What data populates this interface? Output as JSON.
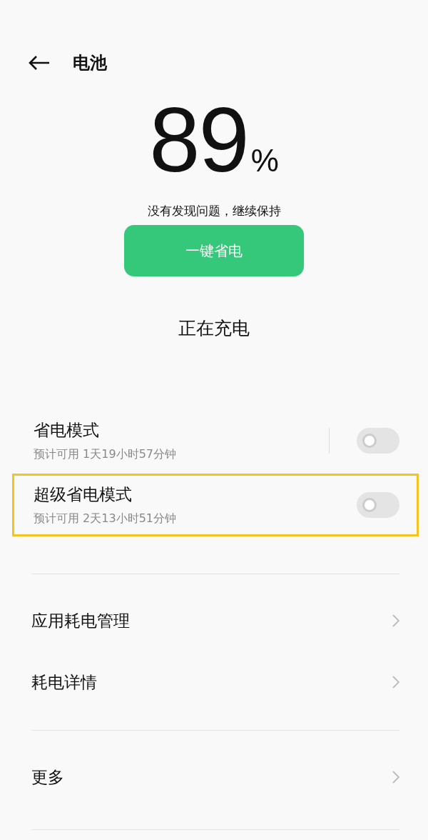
{
  "header": {
    "title": "电池"
  },
  "battery": {
    "value": "89",
    "unit": "%",
    "status": "没有发现问题，继续保持",
    "action_button": "一键省电",
    "charging_status": "正在充电"
  },
  "modes": [
    {
      "title": "省电模式",
      "subtitle": "预计可用 1天19小时57分钟",
      "on": false,
      "highlighted": false,
      "divider": true
    },
    {
      "title": "超级省电模式",
      "subtitle": "预计可用 2天13小时51分钟",
      "on": false,
      "highlighted": true,
      "divider": false
    }
  ],
  "menu_groups": [
    [
      {
        "label": "应用耗电管理"
      },
      {
        "label": "耗电详情"
      }
    ],
    [
      {
        "label": "更多"
      }
    ]
  ]
}
